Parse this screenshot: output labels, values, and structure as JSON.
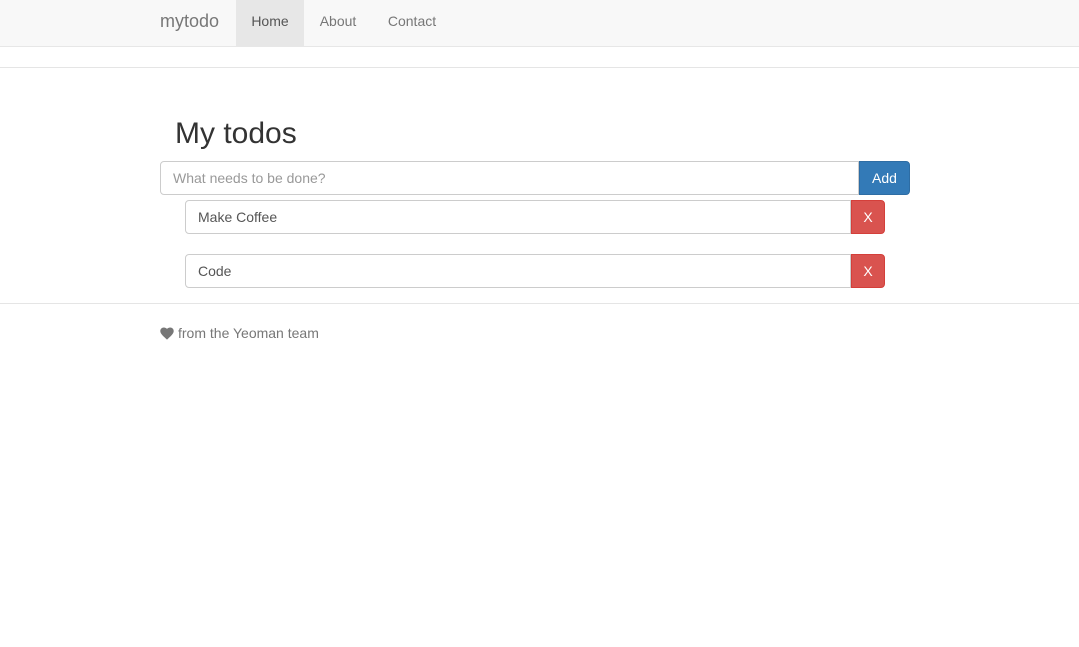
{
  "navbar": {
    "brand": "mytodo",
    "items": [
      {
        "label": "Home",
        "active": true
      },
      {
        "label": "About",
        "active": false
      },
      {
        "label": "Contact",
        "active": false
      }
    ]
  },
  "main": {
    "title": "My todos",
    "new_todo": {
      "placeholder": "What needs to be done?",
      "value": "",
      "add_label": "Add"
    },
    "todos": [
      {
        "text": "Make Coffee",
        "remove_label": "X"
      },
      {
        "text": "Code",
        "remove_label": "X"
      }
    ]
  },
  "footer": {
    "icon": "heart-icon",
    "text": "from the Yeoman team"
  },
  "colors": {
    "primary": "#337ab7",
    "danger": "#d9534f",
    "navbar_bg": "#f8f8f8",
    "nav_active_bg": "#e7e7e7"
  }
}
